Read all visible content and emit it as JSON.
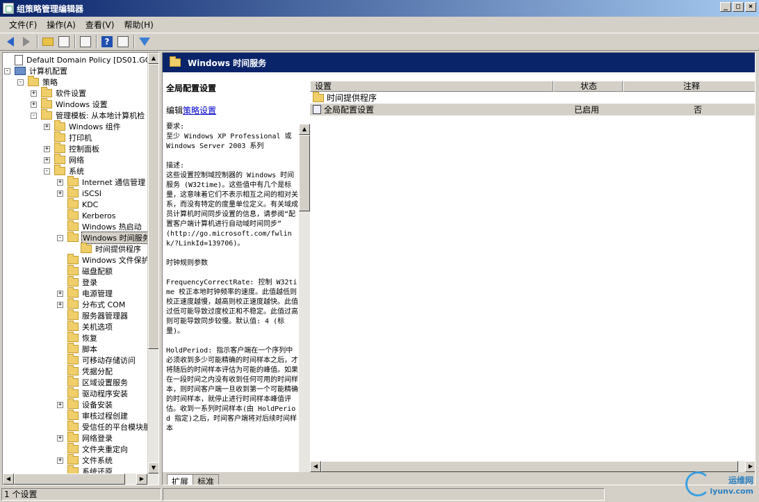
{
  "window": {
    "title": "组策略管理编辑器",
    "controls": [
      "_",
      "□",
      "×"
    ]
  },
  "menu": [
    "文件(F)",
    "操作(A)",
    "查看(V)",
    "帮助(H)"
  ],
  "toolbar": {
    "icons": [
      "back-icon",
      "forward-icon",
      "up-folder-icon",
      "show-hide-tree-icon",
      "export-icon",
      "help-icon",
      "properties-icon",
      "filter-icon"
    ]
  },
  "tree": {
    "items": [
      {
        "label": "Default Domain Policy [DS01.GOODCO",
        "level": 0,
        "exp": "",
        "icon": "doc"
      },
      {
        "label": "计算机配置",
        "level": 0,
        "exp": "-",
        "icon": "comp"
      },
      {
        "label": "策略",
        "level": 1,
        "exp": "-",
        "icon": "folder"
      },
      {
        "label": "软件设置",
        "level": 2,
        "exp": "+",
        "icon": "folder"
      },
      {
        "label": "Windows 设置",
        "level": 2,
        "exp": "+",
        "icon": "folder"
      },
      {
        "label": "管理模板: 从本地计算机检",
        "level": 2,
        "exp": "-",
        "icon": "folder"
      },
      {
        "label": "Windows 组件",
        "level": 3,
        "exp": "+",
        "icon": "folder"
      },
      {
        "label": "打印机",
        "level": 3,
        "exp": "",
        "icon": "folder"
      },
      {
        "label": "控制面板",
        "level": 3,
        "exp": "+",
        "icon": "folder"
      },
      {
        "label": "网络",
        "level": 3,
        "exp": "+",
        "icon": "folder"
      },
      {
        "label": "系统",
        "level": 3,
        "exp": "-",
        "icon": "folder"
      },
      {
        "label": "Internet 通信管理",
        "level": 4,
        "exp": "+",
        "icon": "folder"
      },
      {
        "label": "iSCSI",
        "level": 4,
        "exp": "+",
        "icon": "folder"
      },
      {
        "label": "KDC",
        "level": 4,
        "exp": "",
        "icon": "folder"
      },
      {
        "label": "Kerberos",
        "level": 4,
        "exp": "",
        "icon": "folder"
      },
      {
        "label": "Windows 热启动",
        "level": 4,
        "exp": "",
        "icon": "folder"
      },
      {
        "label": "Windows 时间服务",
        "level": 4,
        "exp": "-",
        "icon": "folder",
        "selected": true
      },
      {
        "label": "时间提供程序",
        "level": 5,
        "exp": "",
        "icon": "folder"
      },
      {
        "label": "Windows 文件保护",
        "level": 4,
        "exp": "",
        "icon": "folder"
      },
      {
        "label": "磁盘配额",
        "level": 4,
        "exp": "",
        "icon": "folder"
      },
      {
        "label": "登录",
        "level": 4,
        "exp": "",
        "icon": "folder"
      },
      {
        "label": "电源管理",
        "level": 4,
        "exp": "+",
        "icon": "folder"
      },
      {
        "label": "分布式 COM",
        "level": 4,
        "exp": "+",
        "icon": "folder"
      },
      {
        "label": "服务器管理器",
        "level": 4,
        "exp": "",
        "icon": "folder"
      },
      {
        "label": "关机选项",
        "level": 4,
        "exp": "",
        "icon": "folder"
      },
      {
        "label": "恢复",
        "level": 4,
        "exp": "",
        "icon": "folder"
      },
      {
        "label": "脚本",
        "level": 4,
        "exp": "",
        "icon": "folder"
      },
      {
        "label": "可移动存储访问",
        "level": 4,
        "exp": "",
        "icon": "folder"
      },
      {
        "label": "凭据分配",
        "level": 4,
        "exp": "",
        "icon": "folder"
      },
      {
        "label": "区域设置服务",
        "level": 4,
        "exp": "",
        "icon": "folder"
      },
      {
        "label": "驱动程序安装",
        "level": 4,
        "exp": "",
        "icon": "folder"
      },
      {
        "label": "设备安装",
        "level": 4,
        "exp": "+",
        "icon": "folder"
      },
      {
        "label": "审核过程创建",
        "level": 4,
        "exp": "",
        "icon": "folder"
      },
      {
        "label": "受信任的平台模块服",
        "level": 4,
        "exp": "",
        "icon": "folder"
      },
      {
        "label": "网络登录",
        "level": 4,
        "exp": "+",
        "icon": "folder"
      },
      {
        "label": "文件夹重定向",
        "level": 4,
        "exp": "",
        "icon": "folder"
      },
      {
        "label": "文件系统",
        "level": 4,
        "exp": "+",
        "icon": "folder"
      },
      {
        "label": "系统还原",
        "level": 4,
        "exp": "",
        "icon": "folder"
      }
    ]
  },
  "header": {
    "title": "Windows 时间服务"
  },
  "description": {
    "title": "全局配置设置",
    "edit_prefix": "编辑",
    "edit_link": "策略设置",
    "body": "要求:\n至少 Windows XP Professional 或 Windows Server 2003 系列\n\n描述:\n这些设置控制域控制器的 Windows 时间服务 (W32time)。这些值中有几个是标量，这意味着它们不表示相互之间的相对关系，而没有特定的度量单位定义。有关域成员计算机时间同步设置的信息，请参阅“配置客户端计算机进行自动域时间同步”\n(http://go.microsoft.com/fwlink/?LinkId=139706)。\n\n时钟规则参数\n\nFrequencyCorrectRate: 控制 W32time 校正本地时钟频率的速度。此值越低则校正速度越慢，越高则校正速度越快。此值过低可能导致过度校正和不稳定。此值过高则可能导致同步较慢。默认值: 4 (标量)。\n\nHoldPeriod: 指示客户端在一个序列中必须收到多少可能精确的时间样本之后，才将随后的时间样本评估为可能的峰值。如果在一段时间之内没有收到任何可用的时间样本，则时间客户端一旦收到第一个可能精确的时间样本，就停止进行时间样本峰值评估。收到一系列时间样本(由 HoldPeriod 指定)之后，时间客户端将对后续时间样本"
  },
  "list": {
    "columns": [
      "设置",
      "状态",
      "注释"
    ],
    "rows": [
      {
        "name": "时间提供程序",
        "state": "",
        "comment": "",
        "icon": "folder"
      },
      {
        "name": "全局配置设置",
        "state": "已启用",
        "comment": "否",
        "icon": "setting"
      }
    ]
  },
  "tabs": [
    "扩展",
    "标准"
  ],
  "status": {
    "text": "1 个设置"
  },
  "watermark": {
    "line1": "运维网",
    "line2": "iyunv.com"
  }
}
